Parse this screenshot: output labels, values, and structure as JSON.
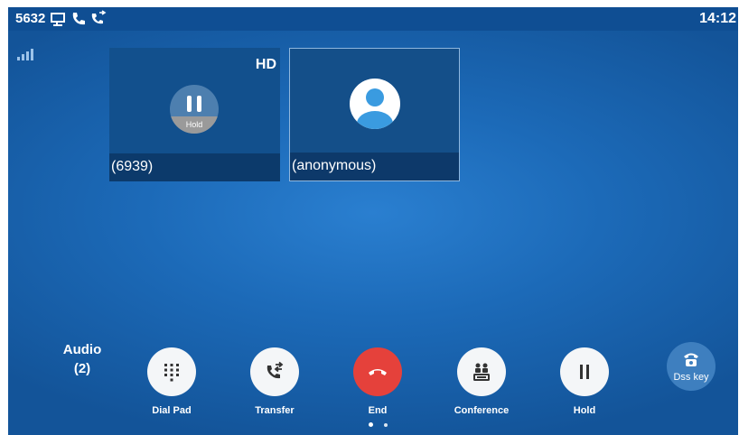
{
  "status_bar": {
    "extension": "5632",
    "time": "14:12",
    "icons": [
      "network-icon",
      "phone-icon",
      "call-forward-icon"
    ]
  },
  "calls": [
    {
      "name": "(6939)",
      "hd_badge": "HD",
      "state_icon": "hold-icon",
      "state_label": "Hold"
    },
    {
      "name": "(anonymous)",
      "state_icon": "contact-avatar-icon"
    }
  ],
  "audio": {
    "label": "Audio",
    "count": "(2)"
  },
  "softkeys": [
    {
      "label": "Dial Pad",
      "icon": "dialpad-icon"
    },
    {
      "label": "Transfer",
      "icon": "transfer-icon"
    },
    {
      "label": "End",
      "icon": "end-call-icon",
      "color": "#e5413b"
    },
    {
      "label": "Conference",
      "icon": "conference-icon"
    },
    {
      "label": "Hold",
      "icon": "pause-icon"
    }
  ],
  "dss_key": {
    "label": "Dss key",
    "icon": "dss-key-icon"
  },
  "page_indicator": {
    "pages": 2,
    "current": 1
  },
  "colors": {
    "background": "#1c6ab8",
    "status_bar": "#0f4e93",
    "end_button": "#e5413b",
    "avatar": "#3a9be0"
  }
}
